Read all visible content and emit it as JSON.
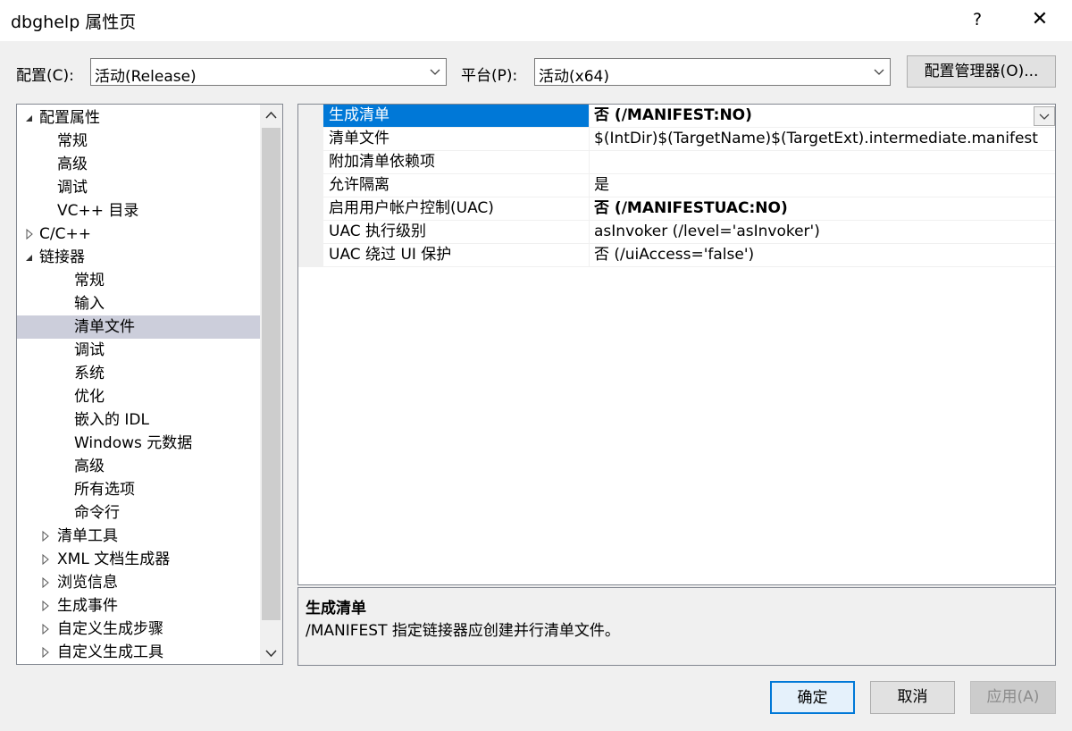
{
  "window": {
    "title": "dbghelp 属性页",
    "help_glyph": "?",
    "close_glyph": "✕"
  },
  "config": {
    "label": "配置(C):",
    "value": "活动(Release)"
  },
  "platform": {
    "label": "平台(P):",
    "value": "活动(x64)"
  },
  "config_manager_label": "配置管理器(O)...",
  "tree": {
    "items": [
      {
        "label": "配置属性",
        "expander": "expanded"
      },
      {
        "label": "常规",
        "expander": ""
      },
      {
        "label": "高级",
        "expander": ""
      },
      {
        "label": "调试",
        "expander": ""
      },
      {
        "label": "VC++ 目录",
        "expander": ""
      },
      {
        "label": "C/C++",
        "expander": "collapsed"
      },
      {
        "label": "链接器",
        "expander": "expanded"
      },
      {
        "label": "常规",
        "expander": ""
      },
      {
        "label": "输入",
        "expander": ""
      },
      {
        "label": "清单文件",
        "expander": "",
        "selected": true
      },
      {
        "label": "调试",
        "expander": ""
      },
      {
        "label": "系统",
        "expander": ""
      },
      {
        "label": "优化",
        "expander": ""
      },
      {
        "label": "嵌入的 IDL",
        "expander": ""
      },
      {
        "label": "Windows 元数据",
        "expander": ""
      },
      {
        "label": "高级",
        "expander": ""
      },
      {
        "label": "所有选项",
        "expander": ""
      },
      {
        "label": "命令行",
        "expander": ""
      },
      {
        "label": "清单工具",
        "expander": "collapsed"
      },
      {
        "label": "XML 文档生成器",
        "expander": "collapsed"
      },
      {
        "label": "浏览信息",
        "expander": "collapsed"
      },
      {
        "label": "生成事件",
        "expander": "collapsed"
      },
      {
        "label": "自定义生成步骤",
        "expander": "collapsed"
      },
      {
        "label": "自定义生成工具",
        "expander": "collapsed"
      }
    ]
  },
  "properties": [
    {
      "name": "生成清单",
      "value": "否 (/MANIFEST:NO)",
      "bold": true,
      "selected": true
    },
    {
      "name": "清单文件",
      "value": "$(IntDir)$(TargetName)$(TargetExt).intermediate.manifest",
      "bold": false
    },
    {
      "name": "附加清单依赖项",
      "value": "",
      "bold": false
    },
    {
      "name": "允许隔离",
      "value": "是",
      "bold": false
    },
    {
      "name": "启用用户帐户控制(UAC)",
      "value": "否 (/MANIFESTUAC:NO)",
      "bold": true
    },
    {
      "name": "UAC 执行级别",
      "value": "asInvoker (/level='asInvoker')",
      "bold": false
    },
    {
      "name": "UAC 绕过 UI 保护",
      "value": "否 (/uiAccess='false')",
      "bold": false
    }
  ],
  "description": {
    "title": "生成清单",
    "text": "/MANIFEST 指定链接器应创建并行清单文件。"
  },
  "buttons": {
    "ok": "确定",
    "cancel": "取消",
    "apply": "应用(A)"
  },
  "colors": {
    "selection": "#0078d7",
    "tree_selection": "#cccedb",
    "dialog_bg": "#f0f0f0"
  }
}
